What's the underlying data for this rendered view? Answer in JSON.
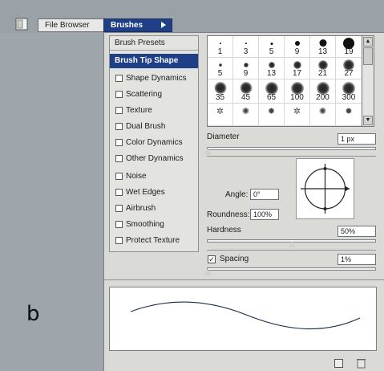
{
  "tabs": [
    {
      "label": "File Browser",
      "active": false
    },
    {
      "label": "Brushes",
      "active": true
    }
  ],
  "left_panel": {
    "header": "Brush Presets",
    "active": "Brush Tip Shape",
    "options": [
      {
        "label": "Shape Dynamics",
        "checked": false
      },
      {
        "label": "Scattering",
        "checked": false
      },
      {
        "label": "Texture",
        "checked": false
      },
      {
        "label": "Dual Brush",
        "checked": false
      },
      {
        "label": "Color Dynamics",
        "checked": false
      },
      {
        "label": "Other Dynamics",
        "checked": false
      },
      {
        "label": "Noise",
        "checked": false
      },
      {
        "label": "Wet Edges",
        "checked": false
      },
      {
        "label": "Airbrush",
        "checked": false
      },
      {
        "label": "Smoothing",
        "checked": false
      },
      {
        "label": "Protect Texture",
        "checked": false
      }
    ]
  },
  "brush_grid": {
    "row1": [
      "1",
      "3",
      "5",
      "9",
      "13",
      "19"
    ],
    "row2": [
      "5",
      "9",
      "13",
      "17",
      "21",
      "27"
    ],
    "row3": [
      "35",
      "45",
      "65",
      "100",
      "200",
      "300"
    ]
  },
  "controls": {
    "diameter_label": "Diameter",
    "diameter_value": "1 px",
    "angle_label": "Angle:",
    "angle_value": "0°",
    "roundness_label": "Roundness:",
    "roundness_value": "100%",
    "hardness_label": "Hardness",
    "hardness_value": "50%",
    "hardness_level": 0.5,
    "spacing_label": "Spacing",
    "spacing_checked": true,
    "spacing_value": "1%",
    "spacing_level": 0.01
  },
  "figure_label": "b",
  "colors": {
    "accent": "#1f3f86",
    "panel": "#dadbd7",
    "background": "#9ea5ab"
  }
}
